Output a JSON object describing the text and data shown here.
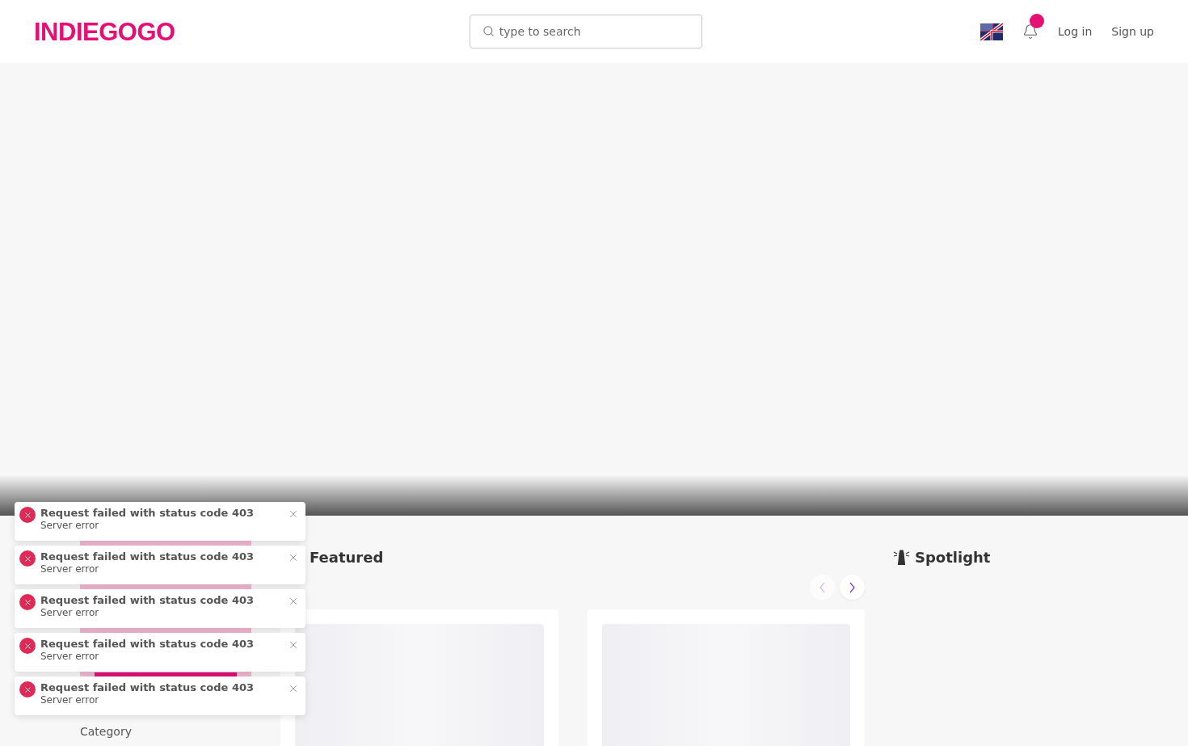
{
  "header": {
    "logo": "INDIEGOGO",
    "search": {
      "placeholder": "type to search"
    },
    "notifications": {
      "unread": true
    },
    "links": [
      "Log in",
      "Sign up"
    ]
  },
  "sidebar": {
    "label": "Category"
  },
  "featured": {
    "title": "Featured",
    "nav": [
      {
        "kind": "prev",
        "disabled": true
      },
      {
        "kind": "next",
        "disabled": false
      }
    ],
    "cards": [
      {
        "kind": "placeholder"
      },
      {
        "kind": "placeholder"
      }
    ]
  },
  "spotlight": {
    "title": "Spotlight"
  },
  "toasts": [
    {
      "title": "Request failed with status code 403",
      "message": "Server error"
    },
    {
      "title": "Request failed with status code 403",
      "message": "Server error"
    },
    {
      "title": "Request failed with status code 403",
      "message": "Server error"
    },
    {
      "title": "Request failed with status code 403",
      "message": "Server error"
    },
    {
      "title": "Request failed with status code 403",
      "message": "Server error"
    }
  ]
}
